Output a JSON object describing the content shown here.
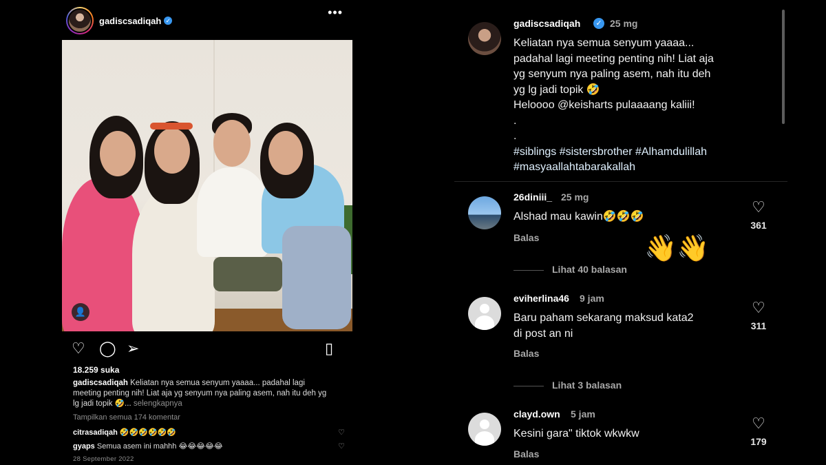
{
  "post": {
    "username": "gadiscsadiqah",
    "more_icon": "more-horizontal-icon",
    "likes": "18.259 suka",
    "caption_user": "gadiscsadiqah",
    "caption_text": "Keliatan nya semua senyum yaaaa... padahal lagi meeting penting nih! Liat aja yg senyum nya paling asem, nah itu deh yg lg jadi topik 🤣...",
    "caption_more": "selengkapnya",
    "view_all_comments": "Tampilkan semua 174 komentar",
    "mini_comments": [
      {
        "user": "citrasadiqah",
        "text": "🤣🤣🤣🤣🤣🤣"
      },
      {
        "user": "gyaps",
        "text": "Semua asem ini mahhh 😂😂😂😂😂"
      }
    ],
    "date": "28 September 2022"
  },
  "caption_panel": {
    "username": "gadiscsadiqah",
    "time": "25 mg",
    "lines": [
      "Keliatan nya semua senyum yaaaa...",
      "padahal lagi meeting penting nih! Liat aja",
      "yg senyum nya paling asem, nah itu deh",
      "yg lg jadi topik 🤣",
      "Heloooo @keisharts pulaaaang kaliii!",
      ".",
      ".",
      "#siblings #sistersbrother #Alhamdulillah",
      "#masyaallahtabarakallah"
    ]
  },
  "comments": [
    {
      "user": "26diniii_",
      "time": "25 mg",
      "text": "Alshad mau kawin🤣🤣🤣",
      "reply": "Balas",
      "likes": "361",
      "thread": "Lihat 40 balasan"
    },
    {
      "user": "eviherlina46",
      "time": "9 jam",
      "text1": "Baru paham sekarang maksud kata2",
      "text2": "di post an ni",
      "reply": "Balas",
      "likes": "311",
      "thread": "Lihat 3 balasan"
    },
    {
      "user": "clayd.own",
      "time": "5 jam",
      "text": "Kesini gara\" tiktok wkwkw",
      "reply": "Balas",
      "likes": "179"
    }
  ],
  "sticker": "👋👋"
}
